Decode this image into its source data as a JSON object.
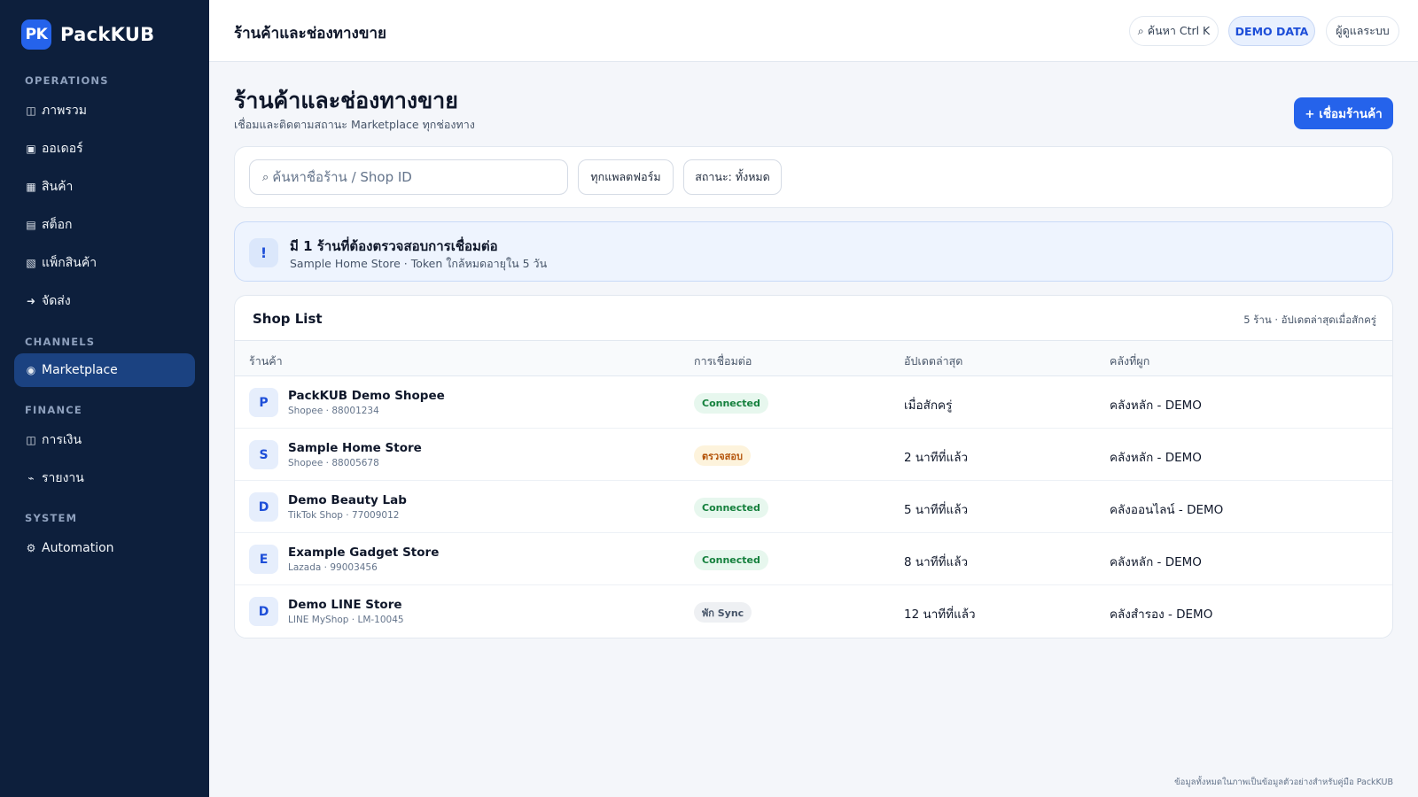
{
  "app": {
    "logo_text": "PK",
    "name": "PackKUB"
  },
  "sidebar": {
    "sections": [
      {
        "label": "OPERATIONS",
        "items": [
          {
            "icon": "◫",
            "label": "ภาพรวม"
          },
          {
            "icon": "▣",
            "label": "ออเดอร์"
          },
          {
            "icon": "▦",
            "label": "สินค้า"
          },
          {
            "icon": "▤",
            "label": "สต็อก"
          },
          {
            "icon": "▧",
            "label": "แพ็กสินค้า"
          },
          {
            "icon": "➜",
            "label": "จัดส่ง"
          }
        ]
      },
      {
        "label": "CHANNELS",
        "items": [
          {
            "icon": "◉",
            "label": "Marketplace",
            "active": true
          }
        ]
      },
      {
        "label": "FINANCE",
        "items": [
          {
            "icon": "◫",
            "label": "การเงิน"
          },
          {
            "icon": "⌁",
            "label": "รายงาน"
          }
        ]
      },
      {
        "label": "SYSTEM",
        "items": [
          {
            "icon": "⚙",
            "label": "Automation"
          }
        ]
      }
    ]
  },
  "topbar": {
    "title": "ร้านค้าและช่องทางขาย",
    "search_label": "⌕ ค้นหา Ctrl K",
    "demo_label": "DEMO DATA",
    "user_label": "ผู้ดูแลระบบ"
  },
  "page": {
    "title": "ร้านค้าและช่องทางขาย",
    "subtitle": "เชื่อมและติดตามสถานะ Marketplace ทุกช่องทาง",
    "connect_button": "+ เชื่อมร้านค้า"
  },
  "filters": {
    "search_icon": "⌕",
    "search_placeholder": "ค้นหาชื่อร้าน / Shop ID",
    "platform_label": "ทุกแพลตฟอร์ม",
    "status_label": "สถานะ: ทั้งหมด"
  },
  "alert": {
    "icon": "!",
    "title": "มี 1 ร้านที่ต้องตรวจสอบการเชื่อมต่อ",
    "detail": "Sample Home Store · Token ใกล้หมดอายุใน 5 วัน"
  },
  "shops": {
    "title": "Shop List",
    "meta": "5 ร้าน · อัปเดตล่าสุดเมื่อสักครู่",
    "columns": [
      "ร้านค้า",
      "การเชื่อมต่อ",
      "อัปเดตล่าสุด",
      "คลังที่ผูก"
    ],
    "rows": [
      {
        "initial": "P",
        "name": "PackKUB Demo Shopee",
        "sub": "Shopee · 88001234",
        "status": "Connected",
        "status_type": "ok",
        "updated": "เมื่อสักครู่",
        "warehouse": "คลังหลัก - DEMO"
      },
      {
        "initial": "S",
        "name": "Sample Home Store",
        "sub": "Shopee · 88005678",
        "status": "ตรวจสอบ",
        "status_type": "warn",
        "updated": "2 นาทีที่แล้ว",
        "warehouse": "คลังหลัก - DEMO"
      },
      {
        "initial": "D",
        "name": "Demo Beauty Lab",
        "sub": "TikTok Shop · 77009012",
        "status": "Connected",
        "status_type": "ok",
        "updated": "5 นาทีที่แล้ว",
        "warehouse": "คลังออนไลน์ - DEMO"
      },
      {
        "initial": "E",
        "name": "Example Gadget Store",
        "sub": "Lazada · 99003456",
        "status": "Connected",
        "status_type": "ok",
        "updated": "8 นาทีที่แล้ว",
        "warehouse": "คลังหลัก - DEMO"
      },
      {
        "initial": "D",
        "name": "Demo LINE Store",
        "sub": "LINE MyShop · LM-10045",
        "status": "พัก Sync",
        "status_type": "paused",
        "updated": "12 นาทีที่แล้ว",
        "warehouse": "คลังสำรอง - DEMO"
      }
    ]
  },
  "footnote": "ข้อมูลทั้งหมดในภาพเป็นข้อมูลตัวอย่างสำหรับคู่มือ PackKUB",
  "colors": {
    "sidebar": "#0d1f3c",
    "accent": "#2563eb",
    "active_nav": "#1b4281"
  }
}
